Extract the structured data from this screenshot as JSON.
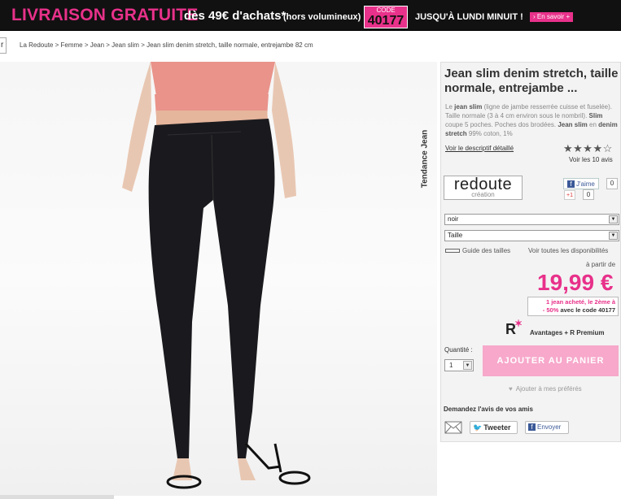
{
  "promo_bar": {
    "headline": "LIVRAISON GRATUITE",
    "condition": "dès 49€ d'achats*",
    "note": "(hors volumineux)",
    "code_label": "CODE",
    "code_value": "40177",
    "deadline": "JUSQU'À LUNDI MINUIT !",
    "more_link": "› En savoir +"
  },
  "nav": {
    "left_button": "r",
    "breadcrumb": "La Redoute  >  Femme  >  Jean  >  Jean slim  >  Jean slim denim stretch, taille normale, entrejambe 82 cm"
  },
  "product": {
    "vertical_label": "Tendance Jean",
    "title": "Jean slim denim stretch, taille normale, entrejambe ...",
    "description": {
      "t1": "Le ",
      "b1": "jean slim",
      "t2": " (ligne de jambe resserrée cuisse et fuselée). Taille normale (3 à 4 cm environ sous le nombril). ",
      "b2": "Slim",
      "t3": " coupe 5 poches. Poches dos brodées. ",
      "b3": "Jean slim",
      "t4": " en ",
      "b4": "denim stretch",
      "t5": "  99% coton, 1%"
    },
    "detail_link": "Voir le descriptif détaillé",
    "rating_stars": "★★★★☆",
    "rating_value": 4,
    "reviews_link": "Voir les 10 avis",
    "brand_line1": "redoute",
    "brand_line2": "création",
    "facebook_like": "J'aime",
    "facebook_count": "0",
    "gplus_label": "+1",
    "gplus_count": "0",
    "color_select": "noir",
    "size_select": "Taille",
    "size_guide": "Guide des tailles",
    "availability_link": "Voir toutes les disponibilités",
    "price_from": "à partir de",
    "price": "19,99 €",
    "offer_line1": "1 jean acheté, le 2ème à",
    "offer_line2a": "- 50%",
    "offer_line2b": " avec le code 40177",
    "premium_logo": "R",
    "premium_text": "Avantages + R Premium",
    "quantity_label": "Quantité :",
    "quantity_value": "1",
    "add_to_cart": "AJOUTER AU PANIER",
    "favorites": "Ajouter à mes préférés",
    "ask_friends": "Demandez l'avis de vos amis",
    "tweet": "Tweeter",
    "send": "Envoyer"
  },
  "colors": {
    "accent": "#e8318a",
    "promo_bg": "#111111",
    "cart_button": "#f7a8cb",
    "panel_bg": "#f3f3f3"
  },
  "icons": [
    "facebook-icon",
    "gplus-icon",
    "ruler-icon",
    "heart-icon",
    "mail-icon",
    "twitter-icon",
    "chevron-down-icon",
    "star-icon"
  ]
}
